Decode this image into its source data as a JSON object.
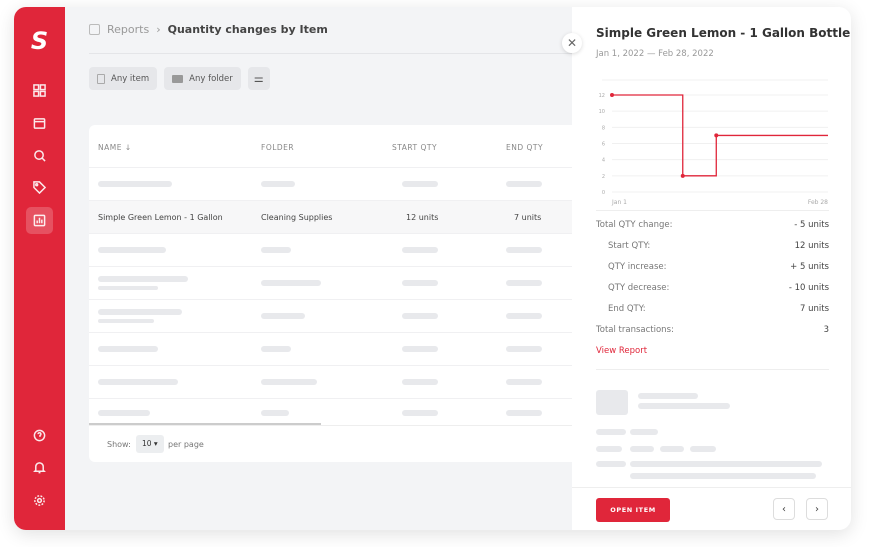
{
  "breadcrumb": {
    "parent": "Reports",
    "current": "Quantity changes by Item"
  },
  "filters": {
    "item": "Any item",
    "folder": "Any folder"
  },
  "table": {
    "headers": [
      "NAME ↓",
      "FOLDER",
      "START QTY",
      "END QTY"
    ],
    "selected_row": {
      "name": "Simple Green Lemon - 1 Gallon",
      "folder": "Cleaning Supplies",
      "start": "12  units",
      "end": "7  units"
    }
  },
  "pagination": {
    "show": "Show:",
    "per_page_value": "10 ▾",
    "per_page": "per page"
  },
  "panel": {
    "title": "Simple Green Lemon - 1 Gallon Bottle",
    "date_range": "Jan 1, 2022 — Feb 28, 2022",
    "stats": [
      {
        "label": "Total QTY change:",
        "value": "- 5 units"
      },
      {
        "label": "Start QTY:",
        "value": "12 units"
      },
      {
        "label": "QTY increase:",
        "value": "+ 5 units"
      },
      {
        "label": "QTY decrease:",
        "value": "- 10 units"
      },
      {
        "label": "End QTY:",
        "value": "7 units"
      },
      {
        "label": "Total transactions:",
        "value": "3"
      }
    ],
    "view_report": "View Report",
    "open_item": "OPEN ITEM"
  },
  "chart_data": {
    "type": "line",
    "step": true,
    "x_labels": [
      "Jan 1",
      "Feb 28"
    ],
    "yticks": [
      0,
      2,
      4,
      6,
      8,
      10,
      12
    ],
    "ylim": [
      0,
      12
    ],
    "grid": true,
    "points": [
      {
        "x": "Jan 1",
        "y": 12
      },
      {
        "x": "Jan 20",
        "y": 2
      },
      {
        "x": "Jan 29",
        "y": 7
      }
    ],
    "end": "Feb 28",
    "color": "#e0263a"
  },
  "colors": {
    "accent": "#e0263a"
  }
}
